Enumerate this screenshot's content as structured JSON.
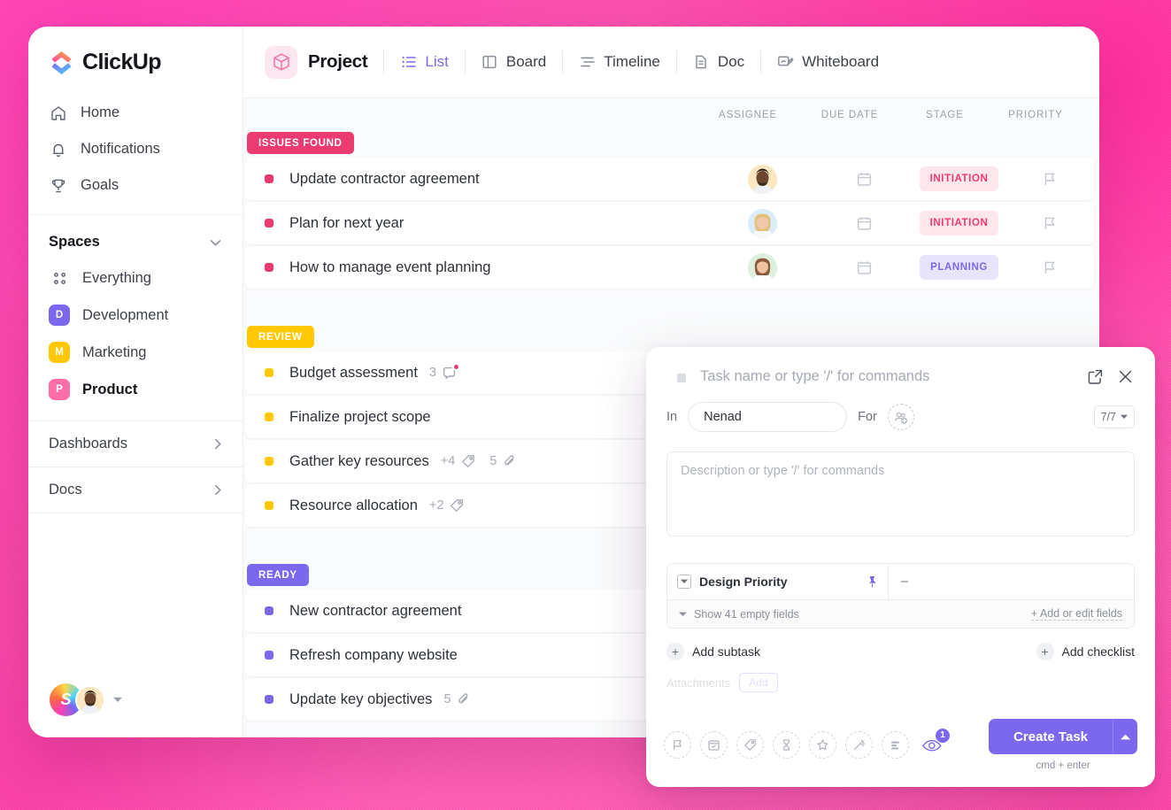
{
  "brand": {
    "name": "ClickUp",
    "accent": "#7b68ee",
    "pink": "#ec3b70",
    "backdrop": "#ff53ab"
  },
  "sidebar": {
    "nav": [
      {
        "label": "Home",
        "icon": "home-icon"
      },
      {
        "label": "Notifications",
        "icon": "bell-icon"
      },
      {
        "label": "Goals",
        "icon": "trophy-icon"
      }
    ],
    "spaces_header": "Spaces",
    "spaces": [
      {
        "label": "Everything",
        "icon": "grid-icon",
        "initial": "",
        "color": "",
        "active": false
      },
      {
        "label": "Development",
        "initial": "D",
        "color": "#7b68ee",
        "active": false
      },
      {
        "label": "Marketing",
        "initial": "M",
        "color": "#ffc801",
        "active": false
      },
      {
        "label": "Product",
        "initial": "P",
        "color": "#ff6ea9",
        "active": true
      }
    ],
    "folders": [
      {
        "label": "Dashboards"
      },
      {
        "label": "Docs"
      }
    ],
    "footer": {
      "workspace_initial": "S"
    }
  },
  "topbar": {
    "project_label": "Project",
    "views": [
      {
        "label": "List",
        "icon": "list-icon",
        "active": true
      },
      {
        "label": "Board",
        "icon": "board-icon",
        "active": false
      },
      {
        "label": "Timeline",
        "icon": "timeline-icon",
        "active": false
      },
      {
        "label": "Doc",
        "icon": "doc-icon",
        "active": false
      },
      {
        "label": "Whiteboard",
        "icon": "whiteboard-icon",
        "active": false
      }
    ]
  },
  "list": {
    "columns": [
      "ASSIGNEE",
      "DUE DATE",
      "STAGE",
      "PRIORITY"
    ],
    "groups": [
      {
        "name": "ISSUES FOUND",
        "badge_bg": "#ec3b70",
        "bullet": "#ec3b70",
        "tasks": [
          {
            "name": "Update contractor agreement",
            "assignee_tint": "#fbe8c0",
            "assignee_skin": "#6b4630",
            "assignee_hair": "#231a16",
            "assignee_shirt": "#eef1f5",
            "stage": "INITIATION",
            "stage_bg": "#fde6ec",
            "stage_color": "#ec3b70",
            "meta": []
          },
          {
            "name": "Plan for next year",
            "assignee_tint": "#d9ecf8",
            "assignee_skin": "#f0c9ab",
            "assignee_hair": "#e5c07a",
            "assignee_shirt": "#f6f8fa",
            "stage": "INITIATION",
            "stage_bg": "#fde6ec",
            "stage_color": "#ec3b70",
            "meta": []
          },
          {
            "name": "How to manage event planning",
            "assignee_tint": "#dcf0dd",
            "assignee_skin": "#eec3a4",
            "assignee_hair": "#8a5a3a",
            "assignee_shirt": "#ffffff",
            "stage": "PLANNING",
            "stage_bg": "#e7e4fc",
            "stage_color": "#7b68ee",
            "meta": []
          }
        ]
      },
      {
        "name": "REVIEW",
        "badge_bg": "#ffc801",
        "bullet": "#ffc801",
        "tasks": [
          {
            "name": "Budget assessment",
            "meta": [
              {
                "type": "comment",
                "count": "3",
                "dot": true
              }
            ]
          },
          {
            "name": "Finalize project scope",
            "meta": []
          },
          {
            "name": "Gather key resources",
            "meta": [
              {
                "type": "tag",
                "count": "+4"
              },
              {
                "type": "attachment",
                "count": "5"
              }
            ]
          },
          {
            "name": "Resource allocation",
            "meta": [
              {
                "type": "tag",
                "count": "+2"
              }
            ]
          }
        ]
      },
      {
        "name": "READY",
        "badge_bg": "#7b68ee",
        "bullet": "#7b68ee",
        "tasks": [
          {
            "name": "New contractor agreement",
            "meta": []
          },
          {
            "name": "Refresh company website",
            "meta": []
          },
          {
            "name": "Update key objectives",
            "meta": [
              {
                "type": "attachment",
                "count": "5"
              }
            ]
          }
        ]
      }
    ]
  },
  "modal": {
    "title_placeholder": "Task name or type '/' for commands",
    "expand_icon": "expand-icon",
    "close_icon": "close-icon",
    "in_label": "In",
    "in_value": "Nenad",
    "for_label": "For",
    "add_assignee_icon": "add-people-icon",
    "count_badge": "7/7",
    "description_placeholder": "Description or type '/' for commands",
    "fields": {
      "rows": [
        {
          "name": "Design Priority",
          "value": "–",
          "pinned": true
        }
      ],
      "show_empty": "Show 41 empty fields",
      "add_or_edit": "+ Add or edit fields"
    },
    "actions": {
      "add_subtask": "Add subtask",
      "add_checklist": "Add checklist"
    },
    "attachments": {
      "label": "Attachments",
      "add_label": "Add"
    },
    "footer_icons": [
      "flag-icon",
      "calendar-check-icon",
      "tag-icon",
      "hourglass-icon",
      "star-icon",
      "magic-wand-icon",
      "priority-bars-icon"
    ],
    "watchers": {
      "icon": "eye-icon",
      "count": "1"
    },
    "create_button": "Create Task",
    "create_caret_icon": "caret-up-icon",
    "shortcut_hint": "cmd + enter"
  }
}
